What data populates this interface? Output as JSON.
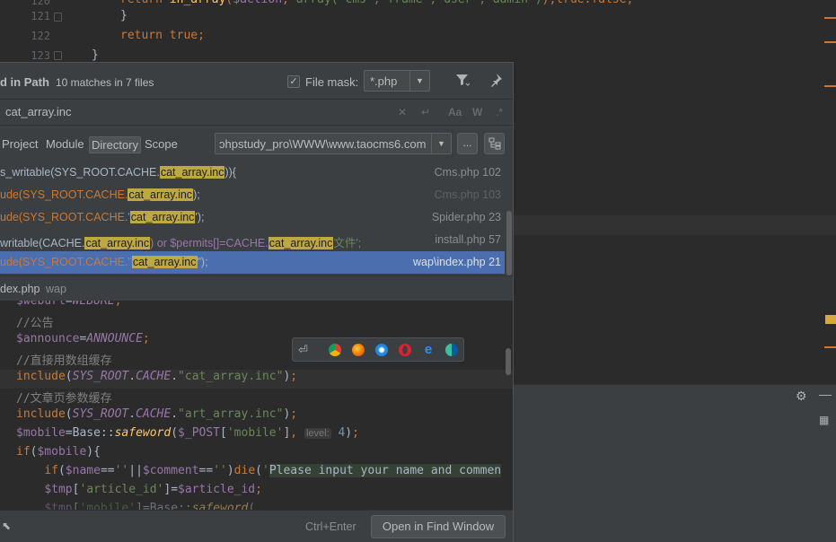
{
  "background_editor": {
    "lines": [
      {
        "num": "120",
        "code": "      return in_array($action, array('cms','frame','user','admin'));true:false;"
      },
      {
        "num": "121",
        "code": "    }"
      },
      {
        "num": "122",
        "code": "    return true;"
      },
      {
        "num": "123",
        "code": "  }"
      }
    ]
  },
  "find": {
    "title": "d in Path",
    "count": "10 matches in 7 files",
    "file_mask_label": "File mask:",
    "file_mask_value": "*.php",
    "query": "cat_array.inc",
    "scopes": [
      "Project",
      "Module",
      "Directory",
      "Scope"
    ],
    "active_scope": "Directory",
    "directory": "ɔhpstudy_pro\\WWW\\www.taocms6.com",
    "browse_label": "...",
    "results": [
      {
        "pre": "s_writable(SYS_ROOT.CACHE.",
        "match": "cat_array.inc",
        "post": ")){",
        "file": "Cms.php 102"
      },
      {
        "pre": "ude(SYS_ROOT.CACHE.",
        "match": "cat_array.inc",
        "post": ");",
        "file": "Cms.php 103"
      },
      {
        "pre": "ude(SYS_ROOT.CACHE.'",
        "match": "cat_array.inc",
        "post": "');",
        "file": "Spider.php 23"
      },
      {
        "pre": "writable(CACHE.",
        "match": "cat_array.inc",
        "post": ") or $permits[]=CACHE.",
        "match2": "cat_array.inc",
        "post2": "文件';",
        "file": "install.php 57"
      },
      {
        "pre": "ude(SYS_ROOT.CACHE.\"",
        "match": "cat_array.inc",
        "post": "\");",
        "file": "wap\\index.php 21"
      }
    ],
    "preview_file": "dex.php",
    "preview_dir": "wap",
    "preview_lines": [
      "$weburl=WEBURL;",
      "//公告",
      "$announce=ANNOUNCE;",
      "//直接用数组缓存",
      "include(SYS_ROOT.CACHE.\"cat_array.inc\");",
      "//文章页参数缓存",
      "include(SYS_ROOT.CACHE.\"art_array.inc\");",
      "$mobile=Base::safeword($_POST['mobile'], level: 4);",
      "if($mobile){",
      "    if($name==''||$comment=='')die('Please input your name and commen",
      "    $tmp['article_id']=$article_id;"
    ],
    "hint_level": "level:",
    "shortcut": "Ctrl+Enter",
    "open_button": "Open in Find Window"
  },
  "colors": {
    "accent_selection": "#4b6eaf",
    "match_highlight": "#bda841"
  }
}
